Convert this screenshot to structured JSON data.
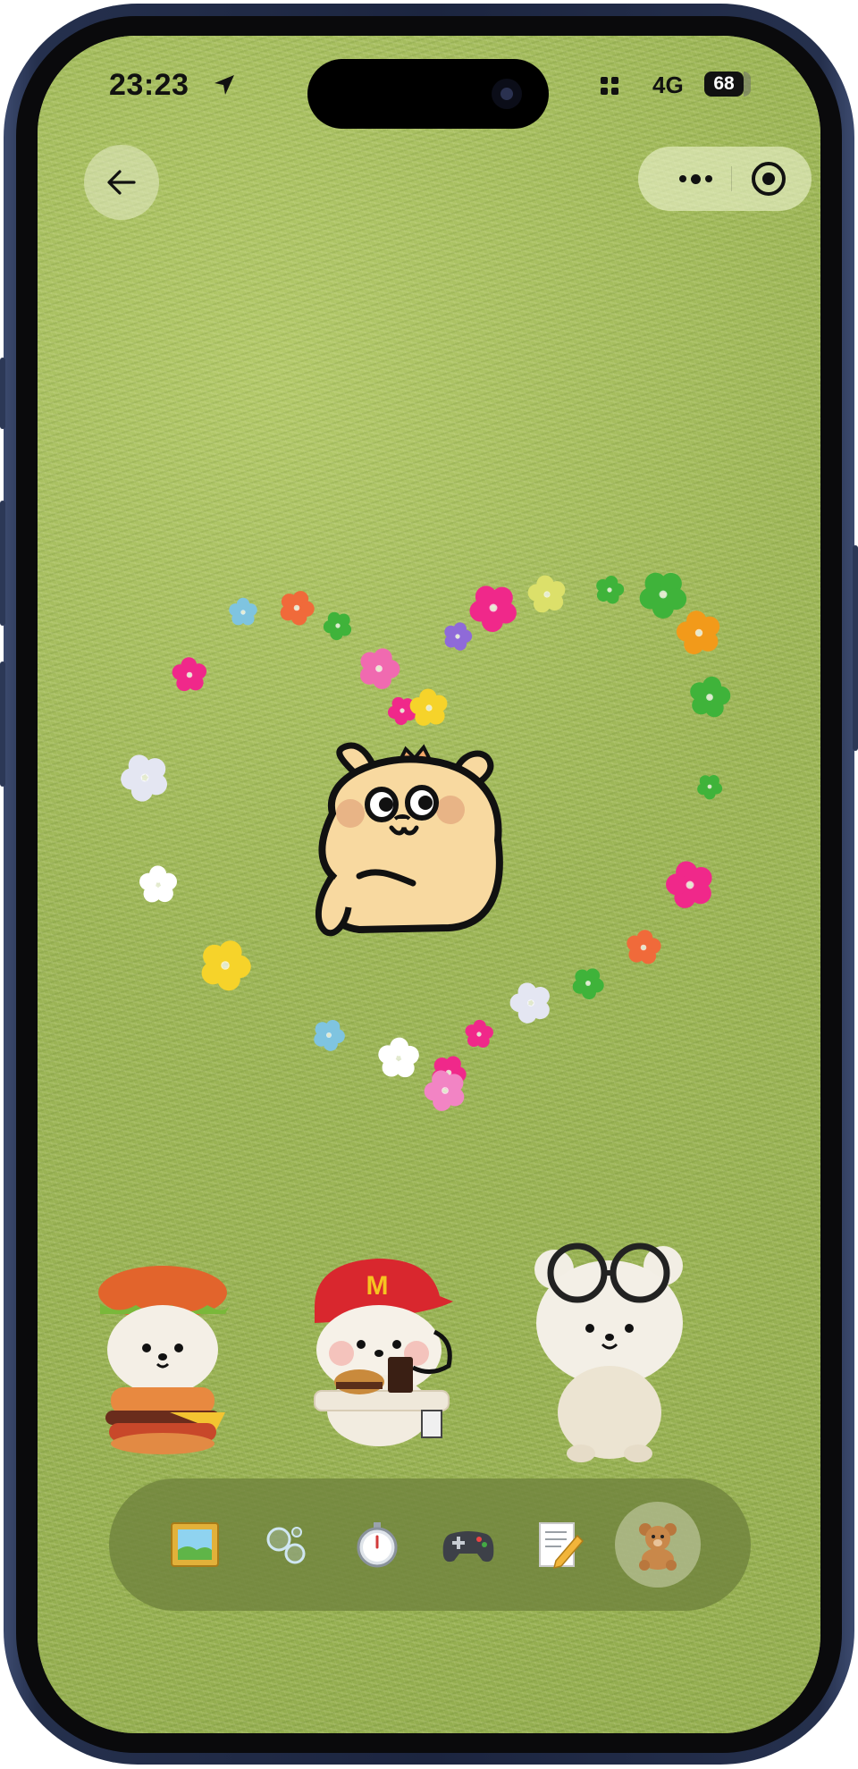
{
  "status_bar": {
    "time": "23:23",
    "network": "4G",
    "battery": "68"
  },
  "top_bar": {
    "back_icon": "arrow-left-icon",
    "more_icon": "more-dots-icon",
    "close_icon": "target-close-icon"
  },
  "scene": {
    "main_character": "bear-sticker",
    "plush_figures": [
      "hamburger-bear-plush",
      "mcdonalds-crew-bear-plush",
      "glasses-bear-plush"
    ],
    "cap_logo": "M"
  },
  "dock": {
    "items": [
      {
        "icon": "framed-picture-icon",
        "active": false
      },
      {
        "icon": "bubbles-icon",
        "active": false
      },
      {
        "icon": "stopwatch-icon",
        "active": false
      },
      {
        "icon": "game-controller-icon",
        "active": false
      },
      {
        "icon": "memo-pencil-icon",
        "active": false
      },
      {
        "icon": "teddy-bear-icon",
        "active": true
      }
    ]
  },
  "colors": {
    "grass": "#9cb556",
    "frame": "#1c2540",
    "dock": "#6e823c"
  }
}
